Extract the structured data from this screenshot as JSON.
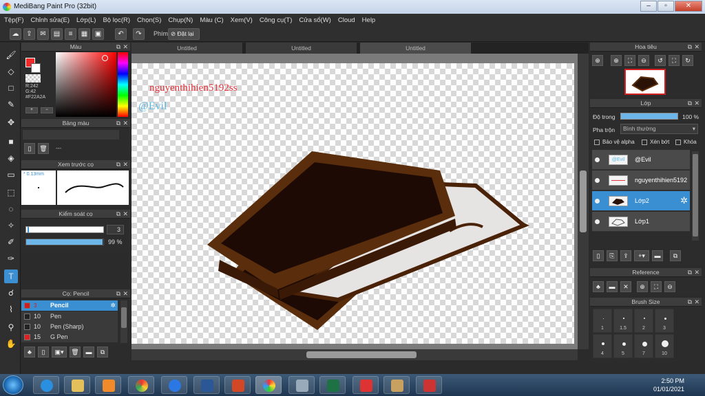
{
  "window": {
    "title": "MediBang Paint Pro (32bit)"
  },
  "menu": [
    "Tệp(F)",
    "Chỉnh sửa(E)",
    "Lớp(L)",
    "Bộ lọc(R)",
    "Chọn(S)",
    "Chụp(N)",
    "Màu (C)",
    "Xem(V)",
    "Công cụ(T)",
    "Cửa sổ(W)",
    "Cloud",
    "Help"
  ],
  "toolbar": {
    "keys_label": "Phím",
    "reset_label": "Đặt lại"
  },
  "color_panel": {
    "title": "Màu",
    "r": "R:242",
    "g": "G:42",
    "hex": "#F22A2A",
    "fg": "#f22a2a"
  },
  "palette_panel": {
    "title": "Bảng màu",
    "value": "---"
  },
  "brush_preview": {
    "title": "Xem trước cọ",
    "size": "0.13mm"
  },
  "brush_control": {
    "title": "Kiểm soát cọ",
    "size": "3",
    "opacity": "99 %",
    "opacity_value": 99
  },
  "brush_list": {
    "title": "Cọ: Pencil",
    "items": [
      {
        "size": "3",
        "name": "Pencil",
        "color": "#d01c1c",
        "selected": true
      },
      {
        "size": "10",
        "name": "Pen",
        "color": "#222222",
        "selected": false
      },
      {
        "size": "10",
        "name": "Pen (Sharp)",
        "color": "#222222",
        "selected": false
      },
      {
        "size": "15",
        "name": "G Pen",
        "color": "#e02020",
        "selected": false
      }
    ]
  },
  "tabs": [
    "Untitled",
    "Untitled",
    "Untitled"
  ],
  "canvas": {
    "watermark_name": "nguyenthihien5192ss",
    "watermark_tag": "@Evil"
  },
  "navigator": {
    "title": "Hoa tiêu"
  },
  "layer_panel": {
    "title": "Lớp",
    "opacity_label": "Độ trong",
    "opacity": "100 %",
    "blend_label": "Pha trộn",
    "blend_value": "Bình thường",
    "protect_alpha": "Bảo vệ alpha",
    "clip": "Xén bớt",
    "lock": "Khóa",
    "layers": [
      {
        "name": "@Evil",
        "thumb": "@Evil",
        "selected": false
      },
      {
        "name": "nguyenthihien5192",
        "thumb": "",
        "selected": false
      },
      {
        "name": "Lớp2",
        "thumb": "",
        "selected": true
      },
      {
        "name": "Lớp1",
        "thumb": "",
        "selected": false
      }
    ]
  },
  "reference_panel": {
    "title": "Reference"
  },
  "brush_size_panel": {
    "title": "Brush Size",
    "sizes": [
      "1",
      "1.5",
      "2",
      "3",
      "4",
      "5",
      "7",
      "10"
    ]
  },
  "taskbar": {
    "time": "2:50 PM",
    "date": "01/01/2021"
  }
}
